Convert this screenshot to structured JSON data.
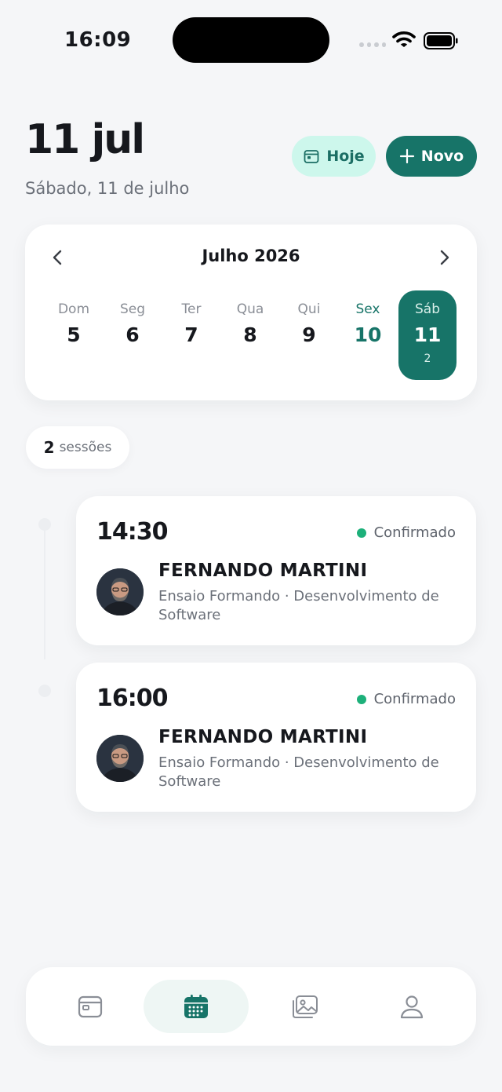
{
  "status_bar": {
    "time": "16:09"
  },
  "header": {
    "title": "11 jul",
    "subtitle": "Sábado, 11 de julho",
    "today_button": "Hoje",
    "new_button": "Novo"
  },
  "calendar": {
    "month_label": "Julho 2026",
    "days": [
      {
        "name": "Dom",
        "number": "5"
      },
      {
        "name": "Seg",
        "number": "6"
      },
      {
        "name": "Ter",
        "number": "7"
      },
      {
        "name": "Qua",
        "number": "8"
      },
      {
        "name": "Qui",
        "number": "9"
      },
      {
        "name": "Sex",
        "number": "10"
      },
      {
        "name": "Sáb",
        "number": "11",
        "count": "2"
      }
    ],
    "today_index": 5,
    "selected_index": 6
  },
  "sessions_summary": {
    "count": "2",
    "label": "sessões"
  },
  "sessions": [
    {
      "time": "14:30",
      "status": "Confirmado",
      "client": "FERNANDO MARTINI",
      "description": "Ensaio Formando · Desenvolvimento de Software"
    },
    {
      "time": "16:00",
      "status": "Confirmado",
      "client": "FERNANDO MARTINI",
      "description": "Ensaio Formando · Desenvolvimento de Software"
    }
  ],
  "bottom_nav": {
    "items": [
      "calendar-icon",
      "calendar-grid-icon",
      "gallery-icon",
      "profile-icon"
    ],
    "active_index": 1
  },
  "colors": {
    "accent": "#177468",
    "accent_light": "#cdf7ec",
    "status_confirmed": "#1db07a",
    "background": "#f5f6f8"
  }
}
